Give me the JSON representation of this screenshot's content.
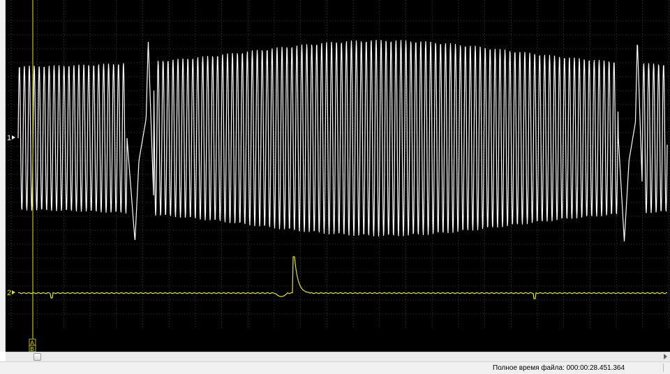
{
  "scope": {
    "background": "#000000",
    "grid_color": "#6a6a6a",
    "channels": [
      {
        "label": "1",
        "color": "#ffffff"
      },
      {
        "label": "2",
        "color": "#e6e600"
      }
    ],
    "cursor": {
      "label_a": "A",
      "label_b": "B",
      "color": "#e6e600"
    }
  },
  "statusbar": {
    "total_time": "Полное время файла: 000:00:28.451.364"
  }
}
